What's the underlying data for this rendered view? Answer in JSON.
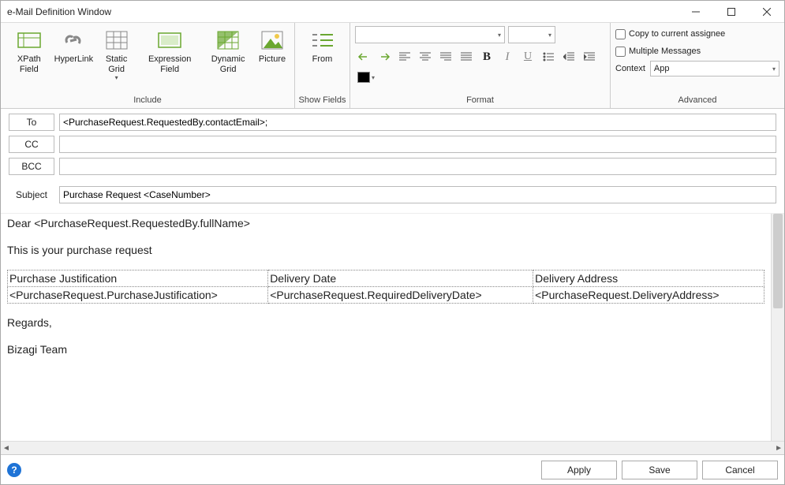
{
  "window": {
    "title": "e-Mail Definition Window"
  },
  "ribbon": {
    "include": {
      "label": "Include",
      "xpath_field": "XPath\nField",
      "hyperlink": "HyperLink",
      "static_grid": "Static\nGrid",
      "expression_field": "Expression\nField",
      "dynamic_grid": "Dynamic\nGrid",
      "picture": "Picture"
    },
    "show_fields": {
      "label": "Show Fields",
      "from": "From"
    },
    "format": {
      "label": "Format"
    },
    "advanced": {
      "label": "Advanced",
      "copy_assignee": "Copy to current assignee",
      "multiple_messages": "Multiple Messages",
      "context_label": "Context",
      "context_value": "App"
    }
  },
  "fields": {
    "to_label": "To",
    "to_value": "<PurchaseRequest.RequestedBy.contactEmail>;",
    "cc_label": "CC",
    "cc_value": "",
    "bcc_label": "BCC",
    "bcc_value": "",
    "subject_label": "Subject",
    "subject_value": "Purchase Request <CaseNumber>"
  },
  "body": {
    "greeting": "Dear <PurchaseRequest.RequestedBy.fullName>",
    "intro": "This is your purchase request",
    "table": {
      "h1": "Purchase Justification",
      "h2": "Delivery Date",
      "h3": "Delivery Address",
      "c1": "<PurchaseRequest.PurchaseJustification>",
      "c2": "<PurchaseRequest.RequiredDeliveryDate>",
      "c3": "<PurchaseRequest.DeliveryAddress>"
    },
    "regards": "Regards,",
    "signature": "Bizagi Team"
  },
  "footer": {
    "apply": "Apply",
    "save": "Save",
    "cancel": "Cancel"
  }
}
